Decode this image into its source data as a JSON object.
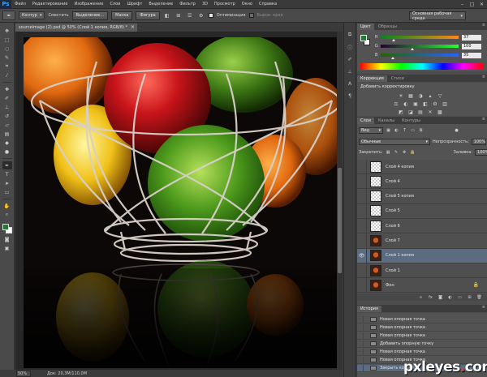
{
  "app": {
    "logo": "Ps"
  },
  "menu": [
    "Файл",
    "Редактирование",
    "Изображение",
    "Слои",
    "Шрифт",
    "Выделение",
    "Фильтр",
    "3D",
    "Просмотр",
    "Окно",
    "Справка"
  ],
  "window_controls": {
    "minimize": "–",
    "maximize": "□",
    "close": "✕"
  },
  "options": {
    "auto_select_label": "Контур",
    "shift_label": "Сместить",
    "refine_label": "Выделение...",
    "mask_label": "Маска",
    "shapes_label": "Фигура",
    "optimize_label": "Оптимизация",
    "align_label": "Выров. края",
    "workspace": "Основная рабочая среда"
  },
  "document": {
    "tab_title": "sourceimage (2).psd @ 50% (Слой 1 копия, RGB/8) *",
    "zoom": "50%",
    "doc_size": "Док: 20,3M/110,0M"
  },
  "color_panel": {
    "tabs": [
      "Цвет",
      "Образцы"
    ],
    "fg_color": "#1f7a33",
    "bg_color": "#ffffff",
    "channels": [
      {
        "label": "R",
        "value": "37",
        "level": 0.145,
        "gradient": "linear-gradient(90deg,#00881a,#ff881a)"
      },
      {
        "label": "G",
        "value": "100",
        "level": 0.39,
        "gradient": "linear-gradient(90deg,#250033,#25ff33)"
      },
      {
        "label": "B",
        "value": "35",
        "level": 0.137,
        "gradient": "linear-gradient(90deg,#256400,#2564ff)"
      }
    ]
  },
  "adjustments_panel": {
    "tabs": [
      "Коррекция",
      "Стили"
    ],
    "title": "Добавить корректировку",
    "row1": [
      "☀",
      "▦",
      "◑",
      "▴",
      "▽"
    ],
    "row2": [
      "⚖",
      "◐",
      "▣",
      "◧",
      "⚙",
      "▥"
    ],
    "row3": [
      "◩",
      "◪",
      "▤",
      "✕",
      "▩"
    ]
  },
  "layers_panel": {
    "tabs": [
      "Слои",
      "Каналы",
      "Контуры"
    ],
    "filter_label": "Вид",
    "blend_mode": "Обычные",
    "opacity_label": "Непрозрачность:",
    "opacity_value": "100%",
    "lock_label": "Закрепить:",
    "fill_label": "Заливка:",
    "fill_value": "100%",
    "layers": [
      {
        "name": "Слой 4 копия",
        "thumb": "transparent",
        "selected": false,
        "visible": false
      },
      {
        "name": "Слой 4",
        "thumb": "transparent",
        "selected": false,
        "visible": false
      },
      {
        "name": "Слой 5 копия",
        "thumb": "transparent",
        "selected": false,
        "visible": false
      },
      {
        "name": "Слой 5",
        "thumb": "transparent",
        "selected": false,
        "visible": false
      },
      {
        "name": "Слой 6",
        "thumb": "transparent",
        "selected": false,
        "visible": false
      },
      {
        "name": "Слой 7",
        "thumb": "image",
        "selected": false,
        "visible": false
      },
      {
        "name": "Слой 1 копия",
        "thumb": "image",
        "selected": true,
        "visible": true
      },
      {
        "name": "Слой 1",
        "thumb": "image",
        "selected": false,
        "visible": false
      },
      {
        "name": "Фон",
        "thumb": "image",
        "selected": false,
        "visible": false,
        "locked": true
      }
    ]
  },
  "history_panel": {
    "tabs": [
      "История"
    ],
    "items": [
      {
        "label": "Новая опорная точка",
        "selected": false
      },
      {
        "label": "Новая опорная точка",
        "selected": false
      },
      {
        "label": "Новая опорная точка",
        "selected": false
      },
      {
        "label": "Добавить опорную точку",
        "selected": false
      },
      {
        "label": "Новая опорная точка",
        "selected": false
      },
      {
        "label": "Новая опорная точка",
        "selected": false
      },
      {
        "label": "Закрыть контур",
        "selected": true
      }
    ]
  },
  "watermark": {
    "text_a": "pxleyes",
    "text_dot": ".",
    "text_b": "com"
  }
}
